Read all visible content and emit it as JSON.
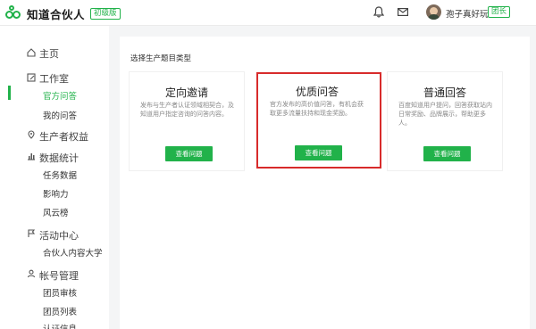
{
  "header": {
    "app_name": "知道合伙人",
    "version_badge": "初级版",
    "user_name": "孢子真好玩",
    "role_badge": "团长"
  },
  "sidebar": {
    "home": "主页",
    "studio": "工作室",
    "studio_items": [
      "官方问答",
      "我的问答"
    ],
    "producer_rights": "生产者权益",
    "data_stats": "数据统计",
    "data_items": [
      "任务数据",
      "影响力",
      "风云榜"
    ],
    "activity_center": "活动中心",
    "activity_items": [
      "合伙人内容大学"
    ],
    "account_mgmt": "帐号管理",
    "account_items": [
      "团员审核",
      "团员列表",
      "认证信息"
    ]
  },
  "main": {
    "section_title": "选择生产题目类型",
    "cards": [
      {
        "title": "定向邀请",
        "desc": "发布与生产者认证领域相契合，及知道用户指定咨询的问答内容。",
        "button": "查看问题"
      },
      {
        "title": "优质问答",
        "desc": "官方发布的高价值问答，有机会获取更多流量扶持和现金奖励。",
        "button": "查看问题"
      },
      {
        "title": "普通回答",
        "desc": "百度知道用户提问，回答获取站内日常奖励、品牌展示，帮助更多人。",
        "button": "查看问题"
      }
    ]
  },
  "colors": {
    "accent": "#21b24a",
    "highlight": "#d82b2b"
  }
}
